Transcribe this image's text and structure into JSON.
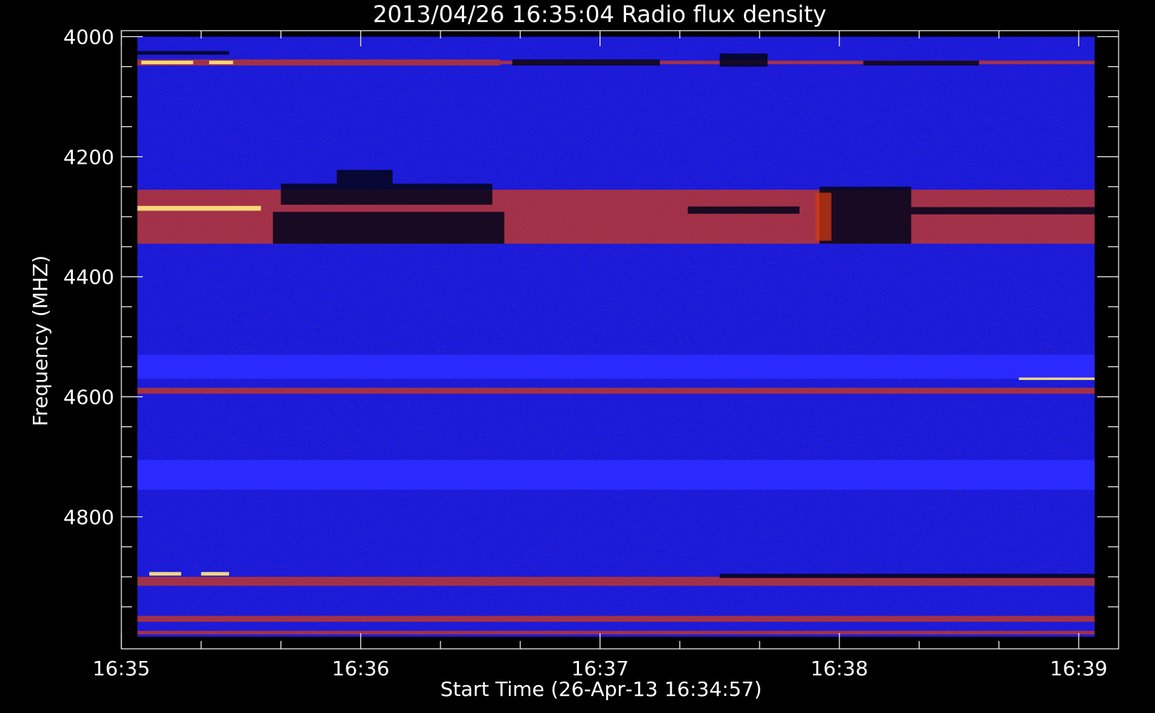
{
  "chart_data": {
    "type": "heatmap",
    "title": "2013/04/26 16:35:04 Radio flux density",
    "xlabel": "Start Time (26‐Apr‐13 16:34:57)",
    "ylabel": "Frequency (MHZ)",
    "xlim": [
      "16:35:00",
      "16:39:10"
    ],
    "ylim": [
      3990,
      5020
    ],
    "y_inverted": true,
    "data_extent": {
      "x": [
        "16:35:04",
        "16:39:04"
      ],
      "y": [
        4000,
        5000
      ]
    },
    "x_ticks": [
      {
        "label": "16:35",
        "value": "16:35:00"
      },
      {
        "label": "16:36",
        "value": "16:36:00"
      },
      {
        "label": "16:37",
        "value": "16:37:00"
      },
      {
        "label": "16:38",
        "value": "16:38:00"
      },
      {
        "label": "16:39",
        "value": "16:39:00"
      }
    ],
    "y_ticks": [
      {
        "label": "4000",
        "value": 4000
      },
      {
        "label": "4200",
        "value": 4200
      },
      {
        "label": "4400",
        "value": 4400
      },
      {
        "label": "4600",
        "value": 4600
      },
      {
        "label": "4800",
        "value": 4800
      }
    ],
    "colors": {
      "background_blue": "#1a1adc",
      "emission_red": "#d63a10",
      "hot_yellow": "#ffe27a",
      "absorption_black": "#05051c",
      "quiet_band_blue": "#2a2aff"
    },
    "features": [
      {
        "kind": "quiet",
        "t": [
          "16:35:04",
          "16:39:04"
        ],
        "f": [
          4530,
          4570
        ]
      },
      {
        "kind": "quiet",
        "t": [
          "16:35:04",
          "16:39:04"
        ],
        "f": [
          4705,
          4755
        ]
      },
      {
        "kind": "emission",
        "t": [
          "16:35:04",
          "16:36:35"
        ],
        "f": [
          4038,
          4048
        ]
      },
      {
        "kind": "emission",
        "t": [
          "16:36:35",
          "16:39:04"
        ],
        "f": [
          4040,
          4046
        ]
      },
      {
        "kind": "hot",
        "t": [
          "16:35:05",
          "16:35:18"
        ],
        "f": [
          4040,
          4046
        ]
      },
      {
        "kind": "hot",
        "t": [
          "16:35:22",
          "16:35:28"
        ],
        "f": [
          4040,
          4046
        ]
      },
      {
        "kind": "absorption",
        "t": [
          "16:35:04",
          "16:35:27"
        ],
        "f": [
          4024,
          4030
        ]
      },
      {
        "kind": "absorption",
        "t": [
          "16:36:38",
          "16:37:15"
        ],
        "f": [
          4038,
          4048
        ]
      },
      {
        "kind": "absorption",
        "t": [
          "16:37:30",
          "16:37:42"
        ],
        "f": [
          4028,
          4050
        ]
      },
      {
        "kind": "absorption",
        "t": [
          "16:38:06",
          "16:38:35"
        ],
        "f": [
          4040,
          4048
        ]
      },
      {
        "kind": "emission",
        "t": [
          "16:35:04",
          "16:39:04"
        ],
        "f": [
          4255,
          4345
        ]
      },
      {
        "kind": "hot",
        "t": [
          "16:35:04",
          "16:35:35"
        ],
        "f": [
          4282,
          4290
        ]
      },
      {
        "kind": "absorption",
        "t": [
          "16:35:40",
          "16:36:33"
        ],
        "f": [
          4245,
          4280
        ]
      },
      {
        "kind": "absorption",
        "t": [
          "16:35:38",
          "16:36:36"
        ],
        "f": [
          4292,
          4345
        ]
      },
      {
        "kind": "absorption",
        "t": [
          "16:35:54",
          "16:36:08"
        ],
        "f": [
          4222,
          4245
        ]
      },
      {
        "kind": "absorption",
        "t": [
          "16:37:22",
          "16:37:50"
        ],
        "f": [
          4283,
          4295
        ]
      },
      {
        "kind": "absorption",
        "t": [
          "16:37:55",
          "16:38:18"
        ],
        "f": [
          4250,
          4345
        ]
      },
      {
        "kind": "absorption",
        "t": [
          "16:38:18",
          "16:39:04"
        ],
        "f": [
          4284,
          4296
        ]
      },
      {
        "kind": "emission",
        "t": [
          "16:37:54",
          "16:37:58"
        ],
        "f": [
          4260,
          4340
        ]
      },
      {
        "kind": "emission",
        "t": [
          "16:35:04",
          "16:39:04"
        ],
        "f": [
          4585,
          4595
        ]
      },
      {
        "kind": "hot",
        "t": [
          "16:38:45",
          "16:39:04"
        ],
        "f": [
          4568,
          4572
        ]
      },
      {
        "kind": "emission",
        "t": [
          "16:35:04",
          "16:39:04"
        ],
        "f": [
          4900,
          4915
        ]
      },
      {
        "kind": "hot",
        "t": [
          "16:35:07",
          "16:35:15"
        ],
        "f": [
          4892,
          4898
        ]
      },
      {
        "kind": "hot",
        "t": [
          "16:35:20",
          "16:35:27"
        ],
        "f": [
          4892,
          4898
        ]
      },
      {
        "kind": "absorption",
        "t": [
          "16:37:30",
          "16:39:04"
        ],
        "f": [
          4895,
          4902
        ]
      },
      {
        "kind": "emission",
        "t": [
          "16:35:04",
          "16:39:04"
        ],
        "f": [
          4965,
          4975
        ]
      },
      {
        "kind": "emission",
        "t": [
          "16:35:04",
          "16:39:04"
        ],
        "f": [
          4990,
          4996
        ]
      }
    ]
  }
}
